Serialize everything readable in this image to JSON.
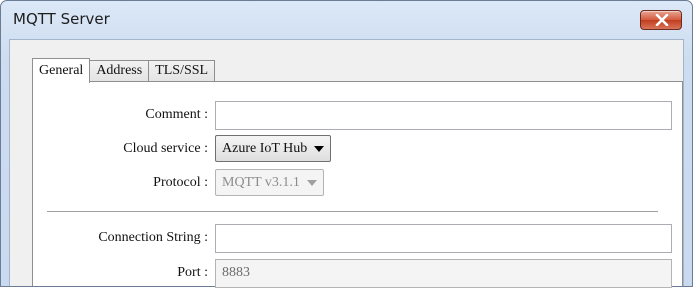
{
  "window": {
    "title": "MQTT Server",
    "close_icon": "close-x-icon"
  },
  "tabs": [
    {
      "label": "General",
      "active": true
    },
    {
      "label": "Address",
      "active": false
    },
    {
      "label": "TLS/SSL",
      "active": false
    }
  ],
  "form": {
    "comment": {
      "label": "Comment :",
      "value": ""
    },
    "cloud_service": {
      "label": "Cloud service :",
      "value": "Azure IoT Hub"
    },
    "protocol": {
      "label": "Protocol :",
      "value": "MQTT v3.1.1",
      "enabled": false
    },
    "connection_string": {
      "label": "Connection String :",
      "value": ""
    },
    "port": {
      "label": "Port :",
      "value": "8883",
      "enabled": false
    }
  },
  "colors": {
    "close_button": "#c23d1f",
    "title_bar": "#dbe8f7"
  }
}
